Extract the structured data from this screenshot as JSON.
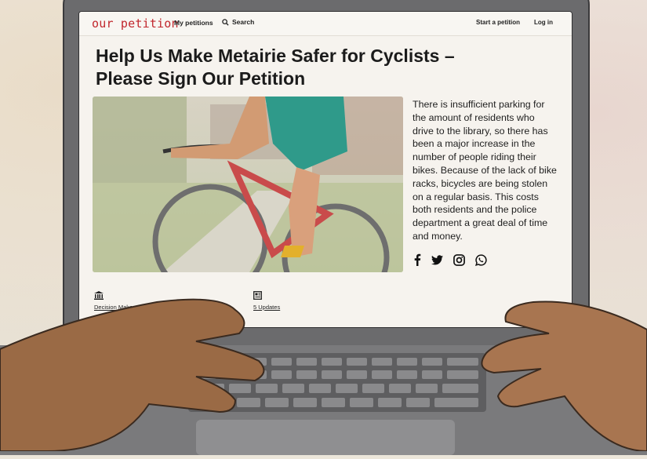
{
  "site": {
    "logo": "our petition",
    "nav_my_petitions": "My petitions",
    "nav_search": "Search",
    "nav_start": "Start a petition",
    "nav_login": "Log in"
  },
  "petition": {
    "title_line1": "Help Us Make Metairie Safer for Cyclists –",
    "title_line2": "Please Sign Our Petition",
    "description": "There is insufficient parking for the amount of residents who drive to the library, so there has been a major increase in the number of people riding their bikes. Because of the lack of bike racks, bicycles are being stolen on a regular basis. This costs both residents and the police department a great deal of time and money.",
    "decision_makers": "Decision Makers: Jaish",
    "updates": "5 Updates"
  },
  "share": [
    "facebook-icon",
    "twitter-icon",
    "instagram-icon",
    "whatsapp-icon"
  ],
  "colors": {
    "logo": "#c1272d",
    "screen": "#f6f3ee",
    "laptop": "#6b6b6d"
  }
}
